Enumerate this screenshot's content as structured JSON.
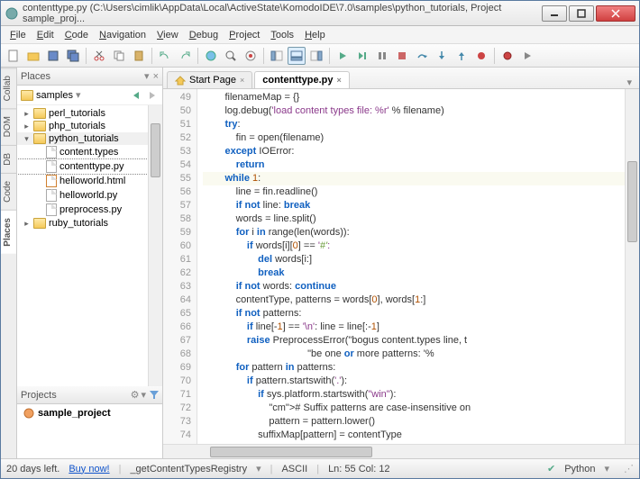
{
  "window": {
    "title": "contenttype.py  (C:\\Users\\cimlik\\AppData\\Local\\ActiveState\\KomodoIDE\\7.0\\samples\\python_tutorials, Project sample_proj..."
  },
  "menu": [
    "File",
    "Edit",
    "Code",
    "Navigation",
    "View",
    "Debug",
    "Project",
    "Tools",
    "Help"
  ],
  "sidetabs": [
    "Collab",
    "DOM",
    "DB",
    "Code",
    "Places"
  ],
  "places": {
    "title": "Places",
    "breadcrumb": "samples",
    "tree": [
      {
        "level": 1,
        "type": "folder",
        "open": false,
        "name": "perl_tutorials"
      },
      {
        "level": 1,
        "type": "folder",
        "open": false,
        "name": "php_tutorials"
      },
      {
        "level": 1,
        "type": "folder",
        "open": true,
        "name": "python_tutorials",
        "sel": true
      },
      {
        "level": 2,
        "type": "file",
        "name": "content.types"
      },
      {
        "level": 2,
        "type": "file",
        "name": "contenttype.py",
        "hl": true
      },
      {
        "level": 2,
        "type": "file",
        "name": "helloworld.html",
        "html": true
      },
      {
        "level": 2,
        "type": "file",
        "name": "helloworld.py"
      },
      {
        "level": 2,
        "type": "file",
        "name": "preprocess.py"
      },
      {
        "level": 1,
        "type": "folder",
        "open": false,
        "name": "ruby_tutorials"
      }
    ]
  },
  "projects": {
    "title": "Projects",
    "item": "sample_project"
  },
  "tabs": [
    {
      "label": "Start Page",
      "active": false,
      "icon": "home"
    },
    {
      "label": "contenttype.py",
      "active": true,
      "icon": "none"
    }
  ],
  "chart_data": {
    "type": "table",
    "language": "python",
    "first_line": 49,
    "cursor": {
      "line": 55,
      "col": 12
    },
    "lines": [
      "        filenameMap = {}",
      "        log.debug('load content types file: %r' % filename)",
      "        try:",
      "            fin = open(filename)",
      "        except IOError:",
      "            return",
      "        while 1:",
      "            line = fin.readline()",
      "            if not line: break",
      "            words = line.split()",
      "            for i in range(len(words)):",
      "                if words[i][0] == '#':",
      "                    del words[i:]",
      "                    break",
      "            if not words: continue",
      "            contentType, patterns = words[0], words[1:]",
      "            if not patterns:",
      "                if line[-1] == '\\n': line = line[:-1]",
      "                raise PreprocessError(\"bogus content.types line, t",
      "                                      \"be one or more patterns: '%",
      "            for pattern in patterns:",
      "                if pattern.startswith('.'):",
      "                    if sys.platform.startswith(\"win\"):",
      "                        # Suffix patterns are case-insensitive on ",
      "                        pattern = pattern.lower()",
      "                    suffixMap[pattern] = contentType"
    ]
  },
  "status": {
    "trial": "20 days left.",
    "buy": "Buy now!",
    "scope": "_getContentTypesRegistry",
    "enc": "ASCII",
    "pos": "Ln: 55 Col: 12",
    "lang": "Python"
  }
}
